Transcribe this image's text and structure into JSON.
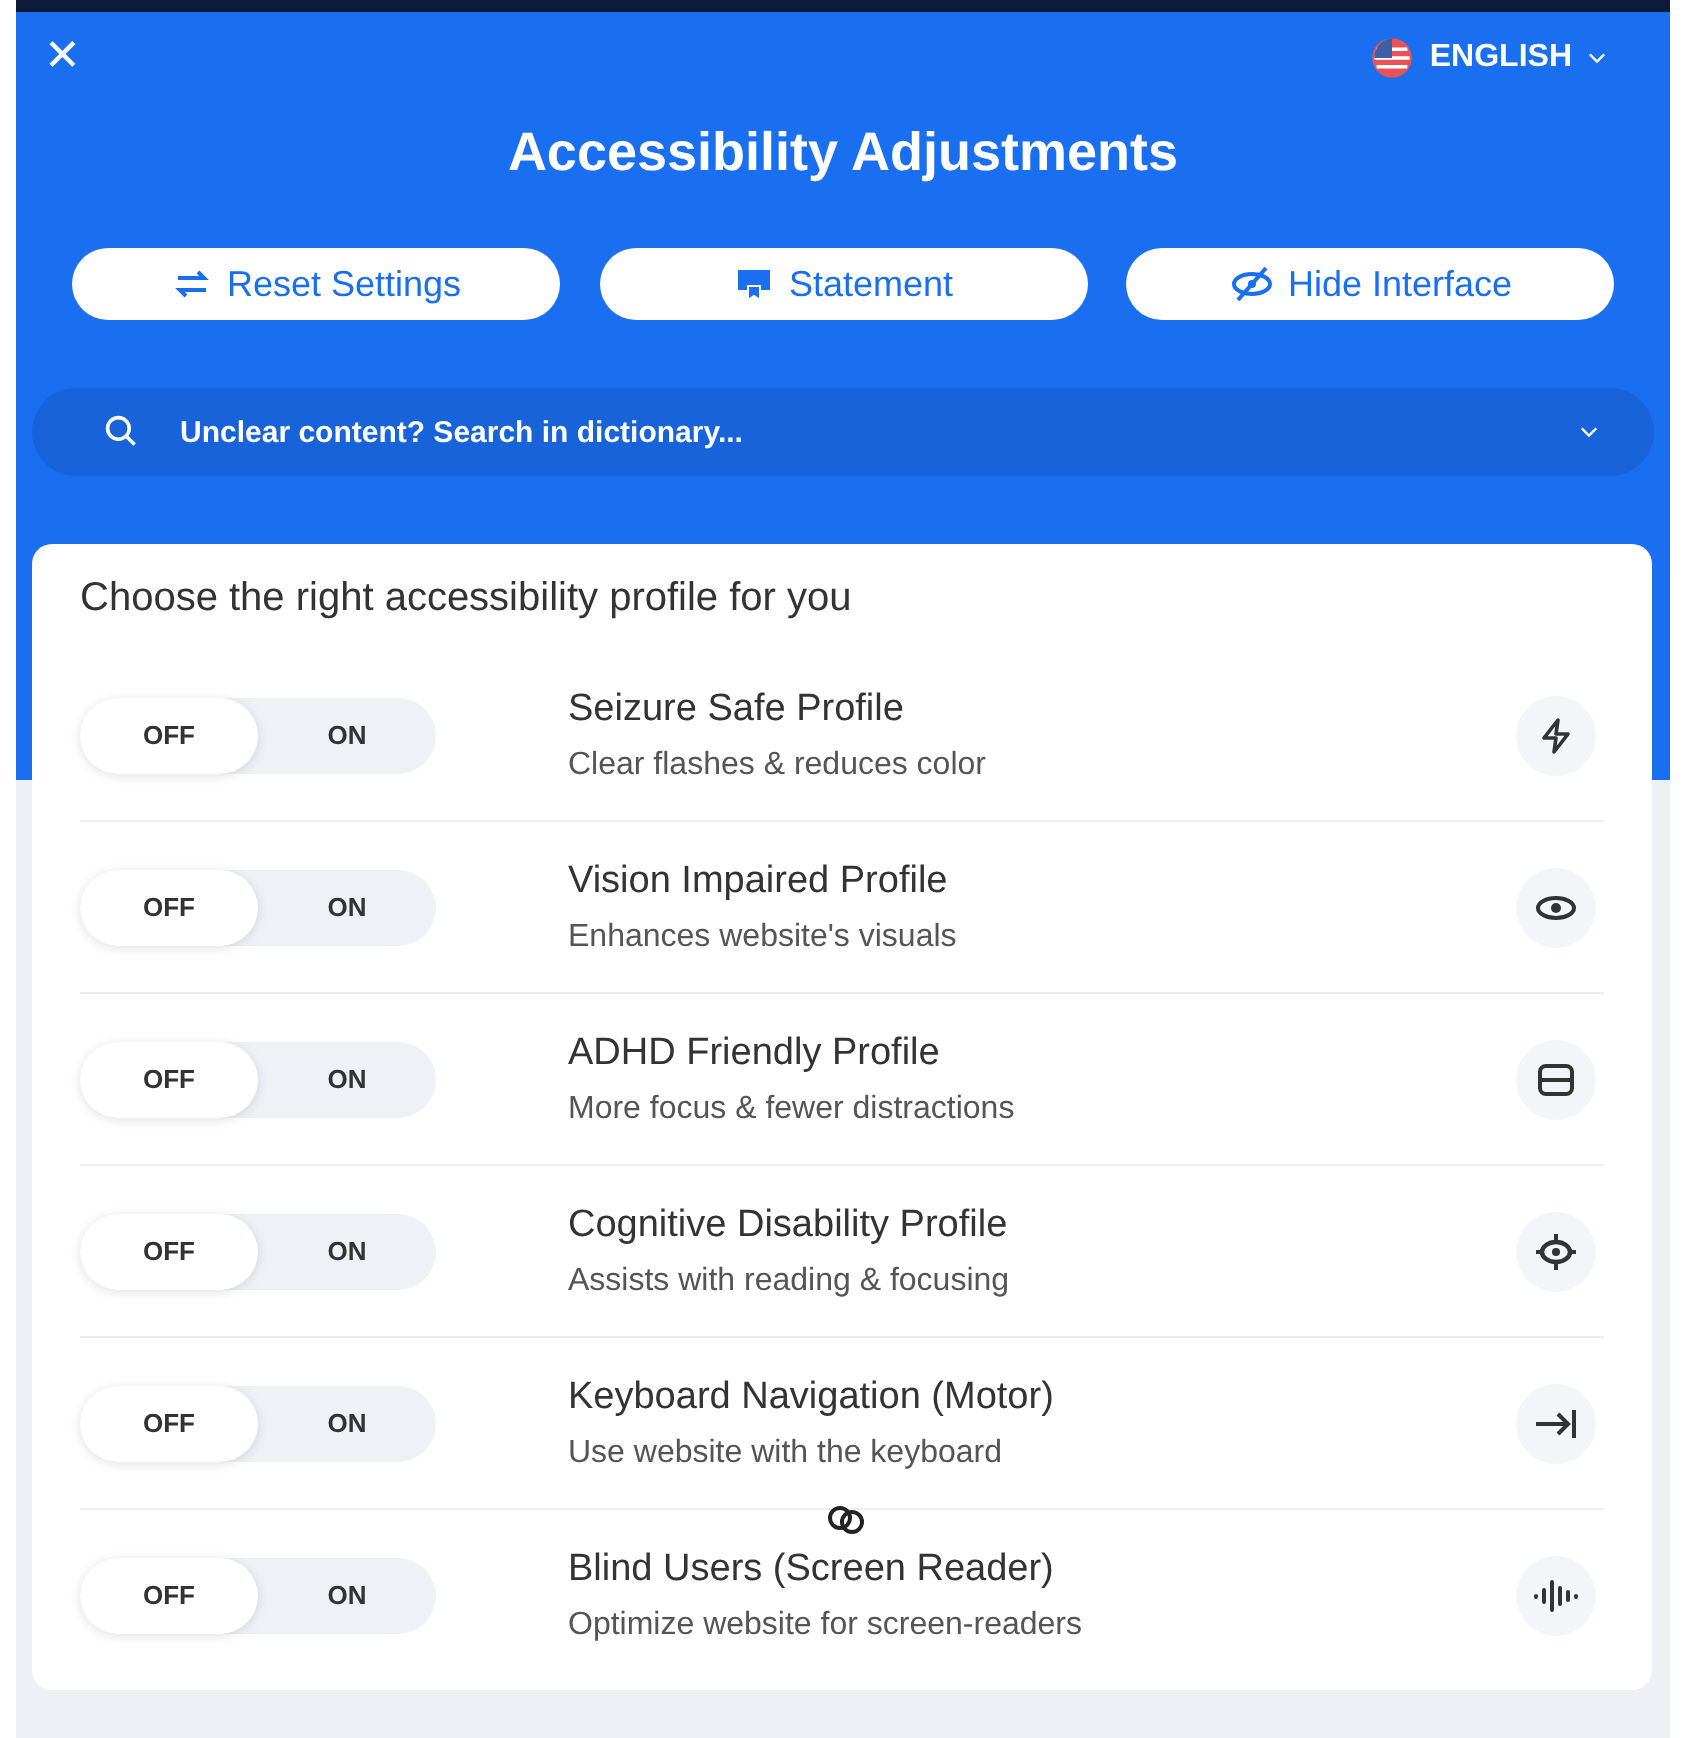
{
  "header": {
    "close": "✕",
    "language": "ENGLISH",
    "title": "Accessibility Adjustments"
  },
  "buttons": [
    {
      "label": "Reset Settings",
      "kind": "reset"
    },
    {
      "label": "Statement",
      "kind": "statement"
    },
    {
      "label": "Hide Interface",
      "kind": "hide"
    }
  ],
  "search": {
    "placeholder": "Unclear content? Search in dictionary..."
  },
  "profiles": {
    "heading": "Choose the right accessibility profile for you",
    "items": [
      {
        "off_label": "OFF",
        "on_label": "ON",
        "on": false,
        "title": "Seizure Safe Profile",
        "description": "Clear flashes & reduces color",
        "kind": "bolt"
      },
      {
        "off_label": "OFF",
        "on_label": "ON",
        "on": false,
        "title": "Vision Impaired Profile",
        "description": "Enhances website's visuals",
        "kind": "eye"
      },
      {
        "off_label": "OFF",
        "on_label": "ON",
        "on": false,
        "title": "ADHD Friendly Profile",
        "description": "More focus & fewer distractions",
        "kind": "frame"
      },
      {
        "off_label": "OFF",
        "on_label": "ON",
        "on": false,
        "title": "Cognitive Disability Profile",
        "description": "Assists with reading & focusing",
        "kind": "target"
      },
      {
        "off_label": "OFF",
        "on_label": "ON",
        "on": false,
        "title": "Keyboard Navigation (Motor)",
        "description": "Use website with the keyboard",
        "kind": "tab"
      },
      {
        "off_label": "OFF",
        "on_label": "ON",
        "on": false,
        "title": "Blind Users (Screen Reader)",
        "description": "Optimize website for screen-readers",
        "kind": "audio"
      }
    ]
  }
}
